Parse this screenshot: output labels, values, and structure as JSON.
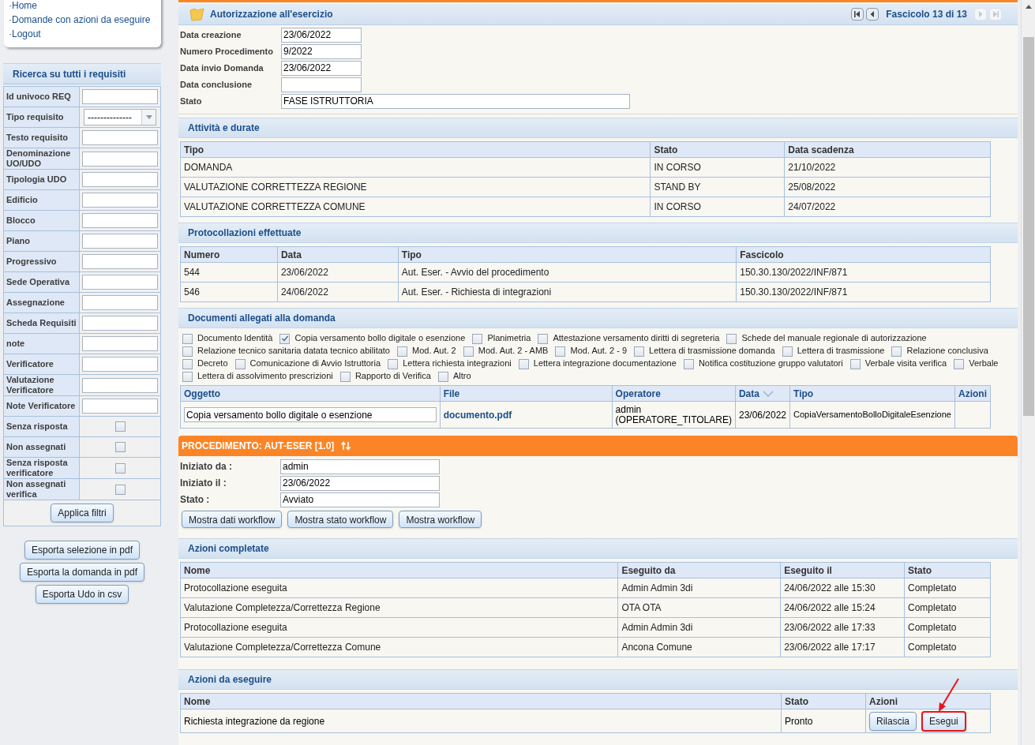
{
  "menu": [
    {
      "label": "·Home"
    },
    {
      "label": "·Domande con azioni da eseguire"
    },
    {
      "label": "·Logout"
    }
  ],
  "search": {
    "title": "Ricerca su tutti i requisiti",
    "filters": [
      {
        "label": "Id univoco REQ",
        "kind": "text"
      },
      {
        "label": "Tipo requisito",
        "kind": "select",
        "value": "--------------"
      },
      {
        "label": "Testo requisito",
        "kind": "text"
      },
      {
        "label": "Denominazione UO/UDO",
        "kind": "text"
      },
      {
        "label": "Tipologia UDO",
        "kind": "text"
      },
      {
        "label": "Edificio",
        "kind": "text"
      },
      {
        "label": "Blocco",
        "kind": "text"
      },
      {
        "label": "Piano",
        "kind": "text"
      },
      {
        "label": "Progressivo",
        "kind": "text"
      },
      {
        "label": "Sede Operativa",
        "kind": "text"
      },
      {
        "label": "Assegnazione",
        "kind": "text"
      },
      {
        "label": "Scheda Requisiti",
        "kind": "text"
      },
      {
        "label": "note",
        "kind": "text"
      },
      {
        "label": "Verificatore",
        "kind": "text"
      },
      {
        "label": "Valutazione Verificatore",
        "kind": "text"
      },
      {
        "label": "Note Verificatore",
        "kind": "text"
      },
      {
        "label": "Senza risposta",
        "kind": "checkbox",
        "checked": false
      },
      {
        "label": "Non assegnati",
        "kind": "checkbox",
        "checked": false
      },
      {
        "label": "Senza risposta verificatore",
        "kind": "checkbox",
        "checked": false
      },
      {
        "label": "Non assegnati verifica",
        "kind": "checkbox",
        "checked": false
      }
    ],
    "apply_button": "Applica filtri"
  },
  "export_buttons": [
    "Esporta selezione in pdf",
    "Esporta la domanda in pdf",
    "Esporta Udo in csv"
  ],
  "header": {
    "title": "Autorizzazione all'esercizio",
    "pager": "Fascicolo 13 di 13",
    "nav": [
      {
        "kind": "first",
        "disabled": false
      },
      {
        "kind": "prev",
        "disabled": false
      },
      {
        "kind": "next",
        "disabled": true
      },
      {
        "kind": "last",
        "disabled": true
      }
    ]
  },
  "info": [
    {
      "label": "Data creazione",
      "value": "23/06/2022",
      "wide": false
    },
    {
      "label": "Numero Procedimento",
      "value": "9/2022",
      "wide": false
    },
    {
      "label": "Data invio Domanda",
      "value": "23/06/2022",
      "wide": false
    },
    {
      "label": "Data conclusione",
      "wide": false
    },
    {
      "label": "Stato",
      "value": "FASE ISTRUTTORIA",
      "wide": true
    }
  ],
  "activities": {
    "title": "Attività e durate",
    "columns": [
      "Tipo",
      "Stato",
      "Data scadenza"
    ],
    "rows": [
      [
        "DOMANDA",
        "IN CORSO",
        "21/10/2022"
      ],
      [
        "VALUTAZIONE CORRETTEZZA REGIONE",
        "STAND BY",
        "25/08/2022"
      ],
      [
        "VALUTAZIONE CORRETTEZZA COMUNE",
        "IN CORSO",
        "24/07/2022"
      ]
    ]
  },
  "protocols": {
    "title": "Protocollazioni effettuate",
    "columns": [
      "Numero",
      "Data",
      "Tipo",
      "Fascicolo"
    ],
    "rows": [
      [
        "544",
        "23/06/2022",
        "Aut. Eser. - Avvio del procedimento",
        "150.30.130/2022/INF/871"
      ],
      [
        "546",
        "24/06/2022",
        "Aut. Eser. - Richiesta di integrazioni",
        "150.30.130/2022/INF/871"
      ]
    ]
  },
  "documents": {
    "title": "Documenti allegati alla domanda",
    "filters": [
      {
        "label": "Documento Identità",
        "checked": false
      },
      {
        "label": "Copia versamento bollo digitale o esenzione",
        "checked": true
      },
      {
        "label": "Planimetria",
        "checked": false
      },
      {
        "label": "Attestazione versamento diritti di segreteria",
        "checked": false
      },
      {
        "label": "Schede del manuale regionale di autorizzazione",
        "checked": false
      },
      {
        "label": "Relazione tecnico sanitaria datata tecnico abilitato",
        "checked": false
      },
      {
        "label": "Mod. Aut. 2",
        "checked": false
      },
      {
        "label": "Mod. Aut. 2 - AMB",
        "checked": false
      },
      {
        "label": "Mod. Aut. 2 - 9",
        "checked": false
      },
      {
        "label": "Lettera di trasmissione domanda",
        "checked": false
      },
      {
        "label": "Lettera di trasmissione",
        "checked": false
      },
      {
        "label": "Relazione conclusiva",
        "checked": false
      },
      {
        "label": "Decreto",
        "checked": false
      },
      {
        "label": "Comunicazione di Avvio Istruttoria",
        "checked": false
      },
      {
        "label": "Lettera richiesta integrazioni",
        "checked": false
      },
      {
        "label": "Lettera integrazione documentazione",
        "checked": false
      },
      {
        "label": "Notifica costituzione gruppo valutatori",
        "checked": false
      },
      {
        "label": "Verbale visita verifica",
        "checked": false
      },
      {
        "label": "Verbale",
        "checked": false
      },
      {
        "label": "Lettera di assolvimento prescrizioni",
        "checked": false
      },
      {
        "label": "Rapporto di Verifica",
        "checked": false
      },
      {
        "label": "Altro",
        "checked": false
      }
    ],
    "columns": [
      {
        "label": "Oggetto",
        "sorted": false
      },
      {
        "label": "File",
        "sorted": false
      },
      {
        "label": "Operatore",
        "sorted": false
      },
      {
        "label": "Data",
        "sorted": true
      },
      {
        "label": "Tipo",
        "sorted": false
      },
      {
        "label": "Azioni",
        "sorted": false
      }
    ],
    "rows": [
      {
        "subject": "Copia versamento bollo digitale o esenzione",
        "file": "documento.pdf",
        "operator": "admin (OPERATORE_TITOLARE)",
        "date": "23/06/2022",
        "type": "CopiaVersamentoBolloDigitaleEsenzione"
      }
    ]
  },
  "procedure": {
    "title": "PROCEDIMENTO: AUT-ESER [1.0]",
    "fields": [
      {
        "label": "Iniziato da :",
        "value": "admin"
      },
      {
        "label": "Iniziato il :",
        "value": "23/06/2022"
      },
      {
        "label": "Stato :",
        "value": "Avviato"
      }
    ],
    "buttons": [
      "Mostra dati workflow",
      "Mostra stato workflow",
      "Mostra workflow"
    ]
  },
  "completed": {
    "title": "Azioni completate",
    "columns": [
      "Nome",
      "Eseguito da",
      "Eseguito il",
      "Stato"
    ],
    "rows": [
      [
        "Protocollazione eseguita",
        "Admin Admin 3di",
        "24/06/2022 alle 15:30",
        "Completato"
      ],
      [
        "Valutazione Completezza/Correttezza Regione",
        "OTA OTA",
        "24/06/2022 alle 15:24",
        "Completato"
      ],
      [
        "Protocollazione eseguita",
        "Admin Admin 3di",
        "23/06/2022 alle 17:33",
        "Completato"
      ],
      [
        "Valutazione Completezza/Correttezza Comune",
        "Ancona Comune",
        "23/06/2022 alle 17:17",
        "Completato"
      ]
    ]
  },
  "pending": {
    "title": "Azioni da eseguire",
    "columns": [
      "Nome",
      "Stato",
      "Azioni"
    ],
    "rows": [
      {
        "name": "Richiesta integrazione da regione",
        "state": "Pronto",
        "actions": [
          {
            "label": "Rilascia",
            "highlighted": false
          },
          {
            "label": "Esegui",
            "highlighted": true
          }
        ]
      }
    ]
  }
}
